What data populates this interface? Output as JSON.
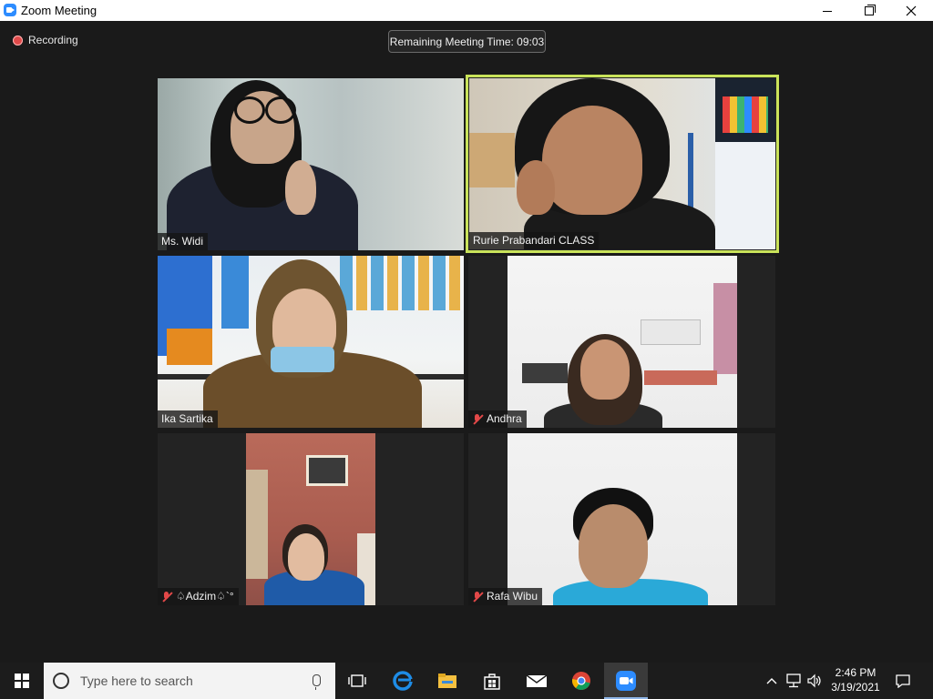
{
  "window": {
    "title": "Zoom Meeting"
  },
  "meeting": {
    "recording_label": "Recording",
    "timer": "Remaining Meeting Time: 09:03",
    "participants": [
      {
        "name": "Ms. Widi",
        "muted": false,
        "active_speaker": false
      },
      {
        "name": "Rurie Prabandari CLASS",
        "muted": false,
        "active_speaker": true
      },
      {
        "name": "Ika Sartika",
        "muted": false,
        "active_speaker": false
      },
      {
        "name": "Andhra",
        "muted": true,
        "active_speaker": false
      },
      {
        "name": "♤Adzim♤`°",
        "muted": true,
        "active_speaker": false
      },
      {
        "name": "Rafa Wibu",
        "muted": true,
        "active_speaker": false
      }
    ]
  },
  "taskbar": {
    "search_placeholder": "Type here to search",
    "time": "2:46 PM",
    "date": "3/19/2021"
  },
  "colors": {
    "active_speaker_border": "#c9e35a",
    "recording_dot": "#e04a4a",
    "zoom_blue": "#2d8cff"
  }
}
